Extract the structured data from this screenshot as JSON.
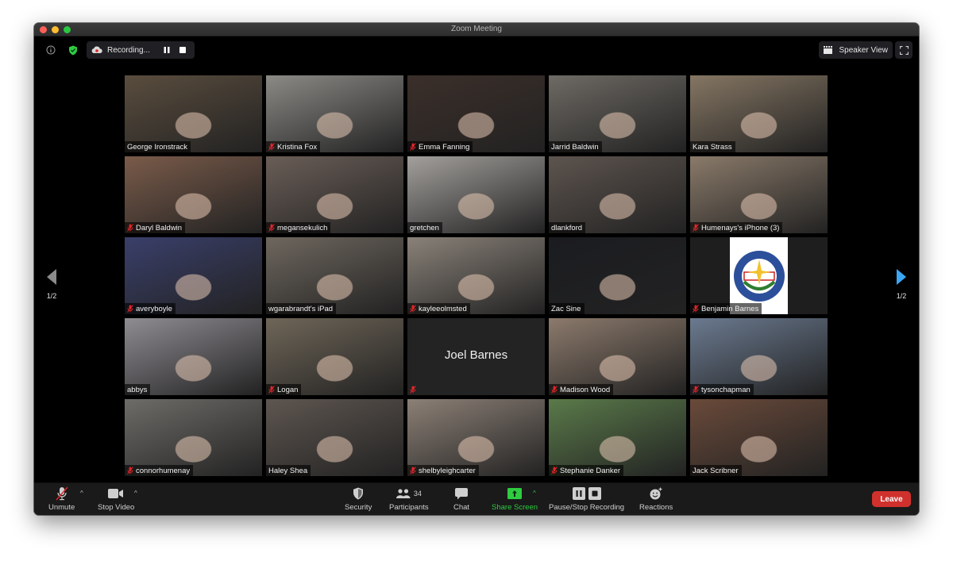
{
  "window": {
    "title": "Zoom Meeting"
  },
  "topbar": {
    "info_icon": "info-icon",
    "security_shield_icon": "shield-check-icon",
    "recording_label": "Recording...",
    "speaker_view_label": "Speaker View"
  },
  "pagination": {
    "left_page": "1/2",
    "right_page": "1/2"
  },
  "colors": {
    "accent_green": "#2ecc40",
    "leave_red": "#d0312d",
    "active_speaker_border": "#d6e58a",
    "nav_arrow_blue": "#3aa7f5",
    "nav_arrow_gray": "#8a8a8a",
    "mute_red": "#e0262a"
  },
  "participants": [
    {
      "name": "George Ironstrack",
      "muted": false,
      "video": true,
      "bg": "#5a4d3e"
    },
    {
      "name": "Kristina Fox",
      "muted": true,
      "video": true,
      "bg": "#8b8a86"
    },
    {
      "name": "Emma Fanning",
      "muted": true,
      "video": true,
      "bg": "#3b2f2a"
    },
    {
      "name": "Jarrid Baldwin",
      "muted": false,
      "video": true,
      "bg": "#6e6a64"
    },
    {
      "name": "Kara Strass",
      "muted": false,
      "video": true,
      "bg": "#857663"
    },
    {
      "name": "Daryl Baldwin",
      "muted": true,
      "video": true,
      "bg": "#7a5b4a"
    },
    {
      "name": "megansekulich",
      "muted": true,
      "video": true,
      "bg": "#6a5e57"
    },
    {
      "name": "gretchen",
      "muted": false,
      "video": true,
      "bg": "#a3a09c"
    },
    {
      "name": "dlankford",
      "muted": false,
      "video": true,
      "bg": "#5d544e"
    },
    {
      "name": "Humenays's iPhone (3)",
      "muted": true,
      "video": true,
      "bg": "#8a7a6a",
      "active": true
    },
    {
      "name": "averyboyle",
      "muted": true,
      "video": true,
      "bg": "#3a3f6a"
    },
    {
      "name": "wgarabrandt's iPad",
      "muted": false,
      "video": true,
      "bg": "#6e675e"
    },
    {
      "name": "kayleeolmsted",
      "muted": true,
      "video": true,
      "bg": "#8a8279"
    },
    {
      "name": "Zac Sine",
      "muted": false,
      "video": true,
      "bg": "#1b1c20"
    },
    {
      "name": "Benjamin Barnes",
      "muted": true,
      "video": true,
      "bg": "#ffffff",
      "seal": true
    },
    {
      "name": "abbys",
      "muted": false,
      "video": true,
      "bg": "#8f8c92"
    },
    {
      "name": "Logan",
      "muted": true,
      "video": true,
      "bg": "#6f6658"
    },
    {
      "name": "Joel Barnes",
      "muted": true,
      "video": false,
      "bg": "#232323",
      "show_name_center": true
    },
    {
      "name": "Madison Wood",
      "muted": true,
      "video": true,
      "bg": "#8c7a6c"
    },
    {
      "name": "tysonchapman",
      "muted": true,
      "video": true,
      "bg": "#6b7a90"
    },
    {
      "name": "connorhumenay",
      "muted": true,
      "video": true,
      "bg": "#6e6c68"
    },
    {
      "name": "Haley Shea",
      "muted": false,
      "video": true,
      "bg": "#5e5650"
    },
    {
      "name": "shelbyleighcarter",
      "muted": true,
      "video": true,
      "bg": "#8c8076"
    },
    {
      "name": "Stephanie Danker",
      "muted": true,
      "video": true,
      "bg": "#5a7a4a"
    },
    {
      "name": "Jack Scribner",
      "muted": false,
      "video": true,
      "bg": "#6a4a3a"
    }
  ],
  "joel_center_name": "Joel Barnes",
  "toolbar": {
    "unmute_label": "Unmute",
    "stop_video_label": "Stop Video",
    "security_label": "Security",
    "participants_label": "Participants",
    "participants_count": "34",
    "chat_label": "Chat",
    "share_screen_label": "Share Screen",
    "recording_label": "Pause/Stop Recording",
    "reactions_label": "Reactions",
    "leave_label": "Leave"
  }
}
